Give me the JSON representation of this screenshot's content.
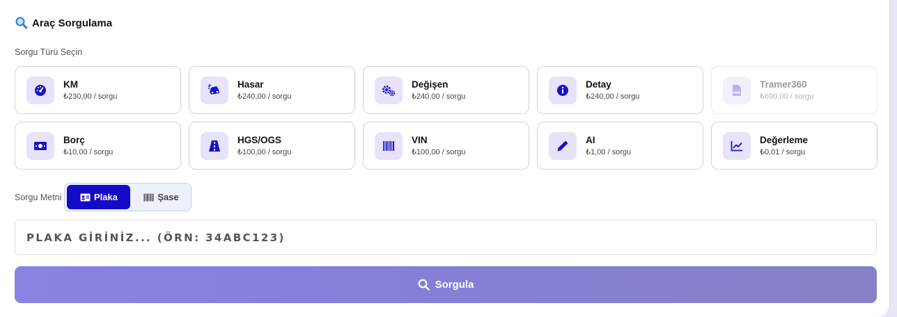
{
  "header": {
    "icon": "magnifier-emoji-icon",
    "title": "Araç Sorgulama"
  },
  "query_type": {
    "label": "Sorgu Türü Seçin",
    "options": [
      {
        "name": "KM",
        "price": "₺230,00 / sorgu",
        "icon": "gauge-icon",
        "disabled": false
      },
      {
        "name": "Hasar",
        "price": "₺240,00 / sorgu",
        "icon": "car-crash-icon",
        "disabled": false
      },
      {
        "name": "Değişen",
        "price": "₺240,00 / sorgu",
        "icon": "gears-icon",
        "disabled": false
      },
      {
        "name": "Detay",
        "price": "₺240,00 / sorgu",
        "icon": "info-circle-icon",
        "disabled": false
      },
      {
        "name": "Tramer360",
        "price": "₺690,00 / sorgu",
        "icon": "png-file-icon",
        "disabled": true
      },
      {
        "name": "Borç",
        "price": "₺10,00 / sorgu",
        "icon": "money-bill-icon",
        "disabled": false
      },
      {
        "name": "HGS/OGS",
        "price": "₺100,00 / sorgu",
        "icon": "road-icon",
        "disabled": false
      },
      {
        "name": "VIN",
        "price": "₺100,00 / sorgu",
        "icon": "barcode-icon",
        "disabled": false
      },
      {
        "name": "AI",
        "price": "₺1,00 / sorgu",
        "icon": "pen-icon",
        "disabled": false
      },
      {
        "name": "Değerleme",
        "price": "₺0,01 / sorgu",
        "icon": "line-chart-icon",
        "disabled": false
      }
    ]
  },
  "query_text": {
    "label": "Sorgu Metni",
    "modes": [
      {
        "label": "Plaka",
        "icon": "id-card-icon",
        "active": true
      },
      {
        "label": "Şase",
        "icon": "barcode-icon",
        "active": false
      }
    ]
  },
  "input": {
    "placeholder": "PLAKA GİRİNİZ... (ÖRN: 34ABC123)",
    "value": ""
  },
  "submit": {
    "label": "Sorgula",
    "icon": "search-icon"
  },
  "colors": {
    "accent": "#140ac8",
    "icon_bg": "#e6e3fb",
    "button_gradient_start": "#8a83e2",
    "button_gradient_end": "#8681c6"
  }
}
